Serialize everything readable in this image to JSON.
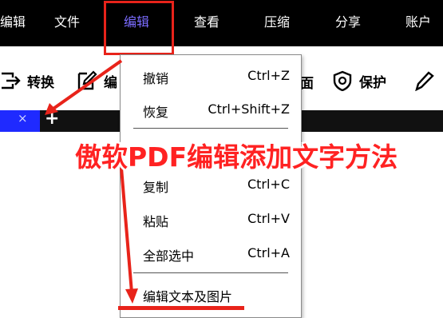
{
  "menubar": {
    "items": [
      "编辑",
      "文件",
      "编辑",
      "查看",
      "压缩",
      "分享",
      "账户"
    ],
    "active_color": "#7b6cff",
    "bg_color": "#000000"
  },
  "toolbar": {
    "convert_label": "转换",
    "edit_label_partial": "编",
    "page_label_partial": "面",
    "protect_label": "保护"
  },
  "tabs": {
    "close_symbol": "×",
    "add_symbol": "+"
  },
  "dropdown": {
    "items": [
      {
        "label": "撤销",
        "shortcut": "Ctrl+Z"
      },
      {
        "label": "恢复",
        "shortcut": "Ctrl+Shift+Z"
      },
      {
        "label": "复制",
        "shortcut": "Ctrl+C"
      },
      {
        "label": "粘贴",
        "shortcut": "Ctrl+V"
      },
      {
        "label": "全部选中",
        "shortcut": "Ctrl+A"
      },
      {
        "label": "编辑文本及图片",
        "shortcut": ""
      }
    ]
  },
  "overlay": {
    "caption": "傲软PDF编辑添加文字方法",
    "annotation_color": "#e8231a"
  }
}
